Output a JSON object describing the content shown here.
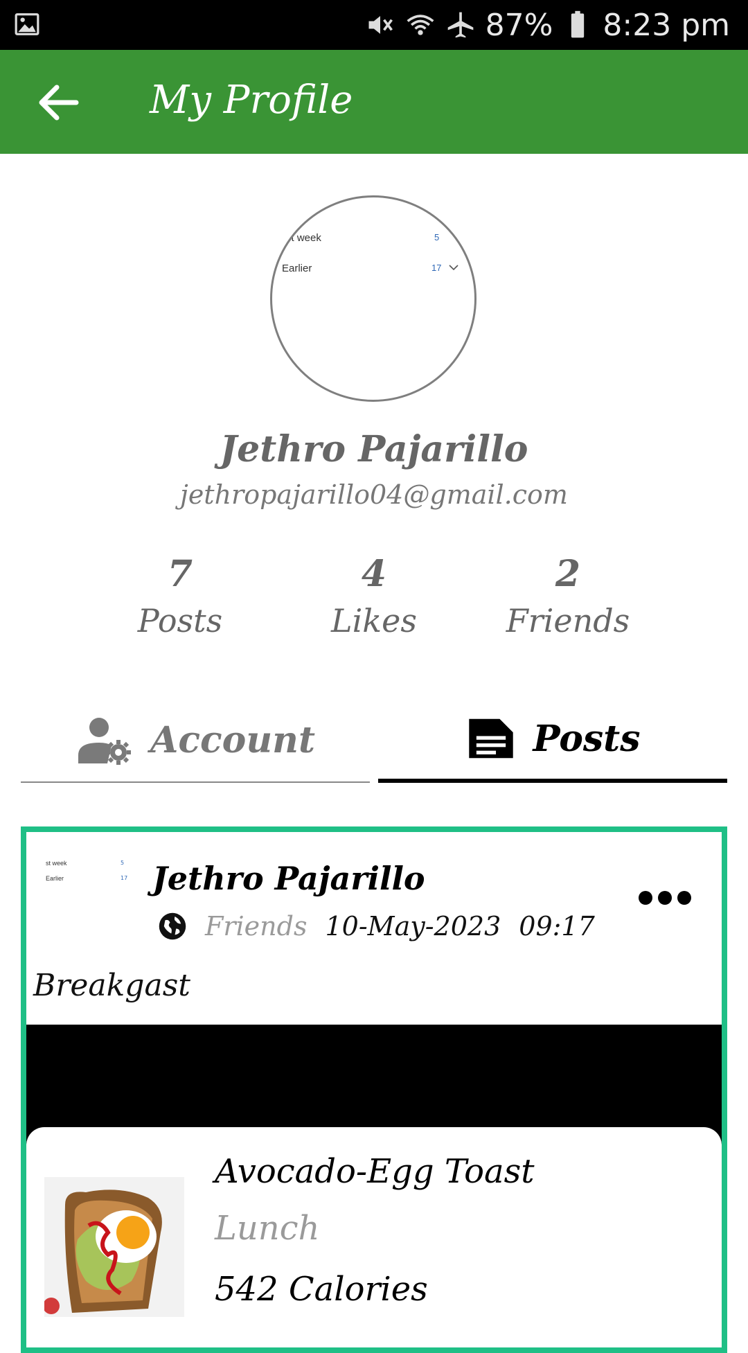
{
  "status_bar": {
    "battery": "87%",
    "time": "8:23 pm",
    "icons": [
      "gallery-icon",
      "mute-icon",
      "wifi-icon",
      "airplane-icon",
      "battery-icon"
    ]
  },
  "header": {
    "title": "My Profile",
    "back_icon": "arrow-left-icon",
    "bg_color": "#3a9435"
  },
  "profile": {
    "avatar_preview": {
      "row1_label": "st week",
      "row1_count": "5",
      "row2_label": "Earlier",
      "row2_count": "17"
    },
    "name": "Jethro Pajarillo",
    "email": "jethropajarillo04@gmail.com",
    "stats": [
      {
        "value": "7",
        "label": "Posts"
      },
      {
        "value": "4",
        "label": "Likes"
      },
      {
        "value": "2",
        "label": "Friends"
      }
    ]
  },
  "tabs": [
    {
      "label": "Account",
      "icon": "user-settings-icon",
      "selected": false
    },
    {
      "label": "Posts",
      "icon": "document-icon",
      "selected": true
    }
  ],
  "post": {
    "author": "Jethro Pajarillo",
    "visibility": "Friends",
    "date": "10-May-2023",
    "time": "09:17",
    "caption": "Breakgast",
    "thumb_preview": {
      "row1_label": "st week",
      "row1_count": "5",
      "row2_label": "Earlier",
      "row2_count": "17"
    },
    "food": {
      "name": "Avocado-Egg Toast",
      "meal": "Lunch",
      "calories": "542 Calories"
    },
    "border_color": "#1fbf86"
  }
}
